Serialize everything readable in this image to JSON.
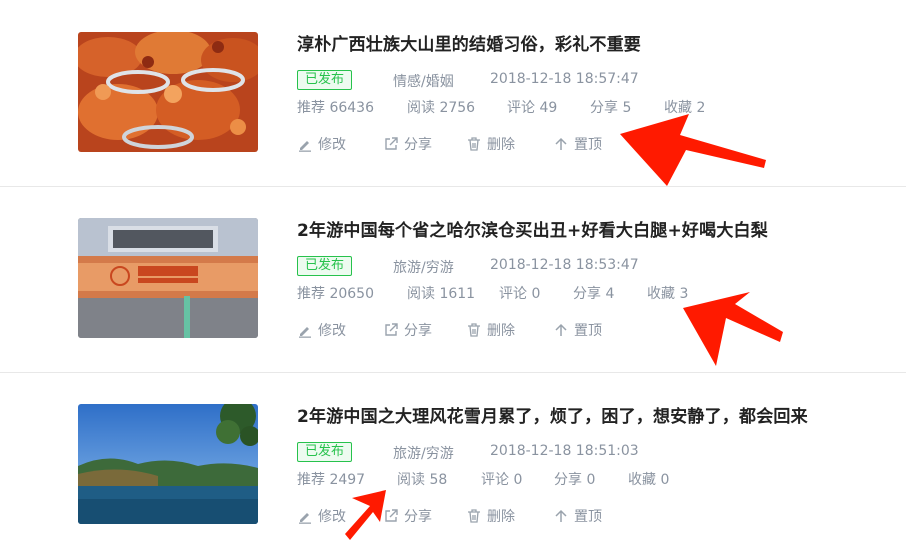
{
  "articles": [
    {
      "title": "淳朴广西壮族大山里的结婚习俗，彩礼不重要",
      "status": "已发布",
      "category": "情感/婚姻",
      "time": "2018-12-18 18:57:47",
      "stats": [
        "推荐 66436",
        "阅读 2756",
        "评论 49",
        "分享 5",
        "收藏 2"
      ],
      "thumb_desc": "crayfish-platter"
    },
    {
      "title": "2年游中国每个省之哈尔滨仓买出丑+好看大白腿+好喝大白梨",
      "status": "已发布",
      "category": "旅游/穷游",
      "time": "2018-12-18 18:53:47",
      "stats": [
        "推荐 20650",
        "阅读 1611",
        "评论 0",
        "分享 4",
        "收藏 3"
      ],
      "thumb_desc": "harbin-map-roll"
    },
    {
      "title": "2年游中国之大理风花雪月累了，烦了，困了，想安静了，都会回来",
      "status": "已发布",
      "category": "旅游/穷游",
      "time": "2018-12-18 18:51:03",
      "stats": [
        "推荐 2497",
        "阅读 58",
        "评论 0",
        "分享 0",
        "收藏 0"
      ],
      "thumb_desc": "lake-landscape"
    }
  ],
  "actions": {
    "edit": "修改",
    "share": "分享",
    "delete": "删除",
    "top": "置顶"
  },
  "icons": [
    "edit-icon",
    "share-icon",
    "trash-icon",
    "arrow-up-icon"
  ],
  "colors": {
    "badge_green": "#27c24c",
    "meta_gray": "#8a93a0",
    "annotation_red": "#ff1a00"
  }
}
